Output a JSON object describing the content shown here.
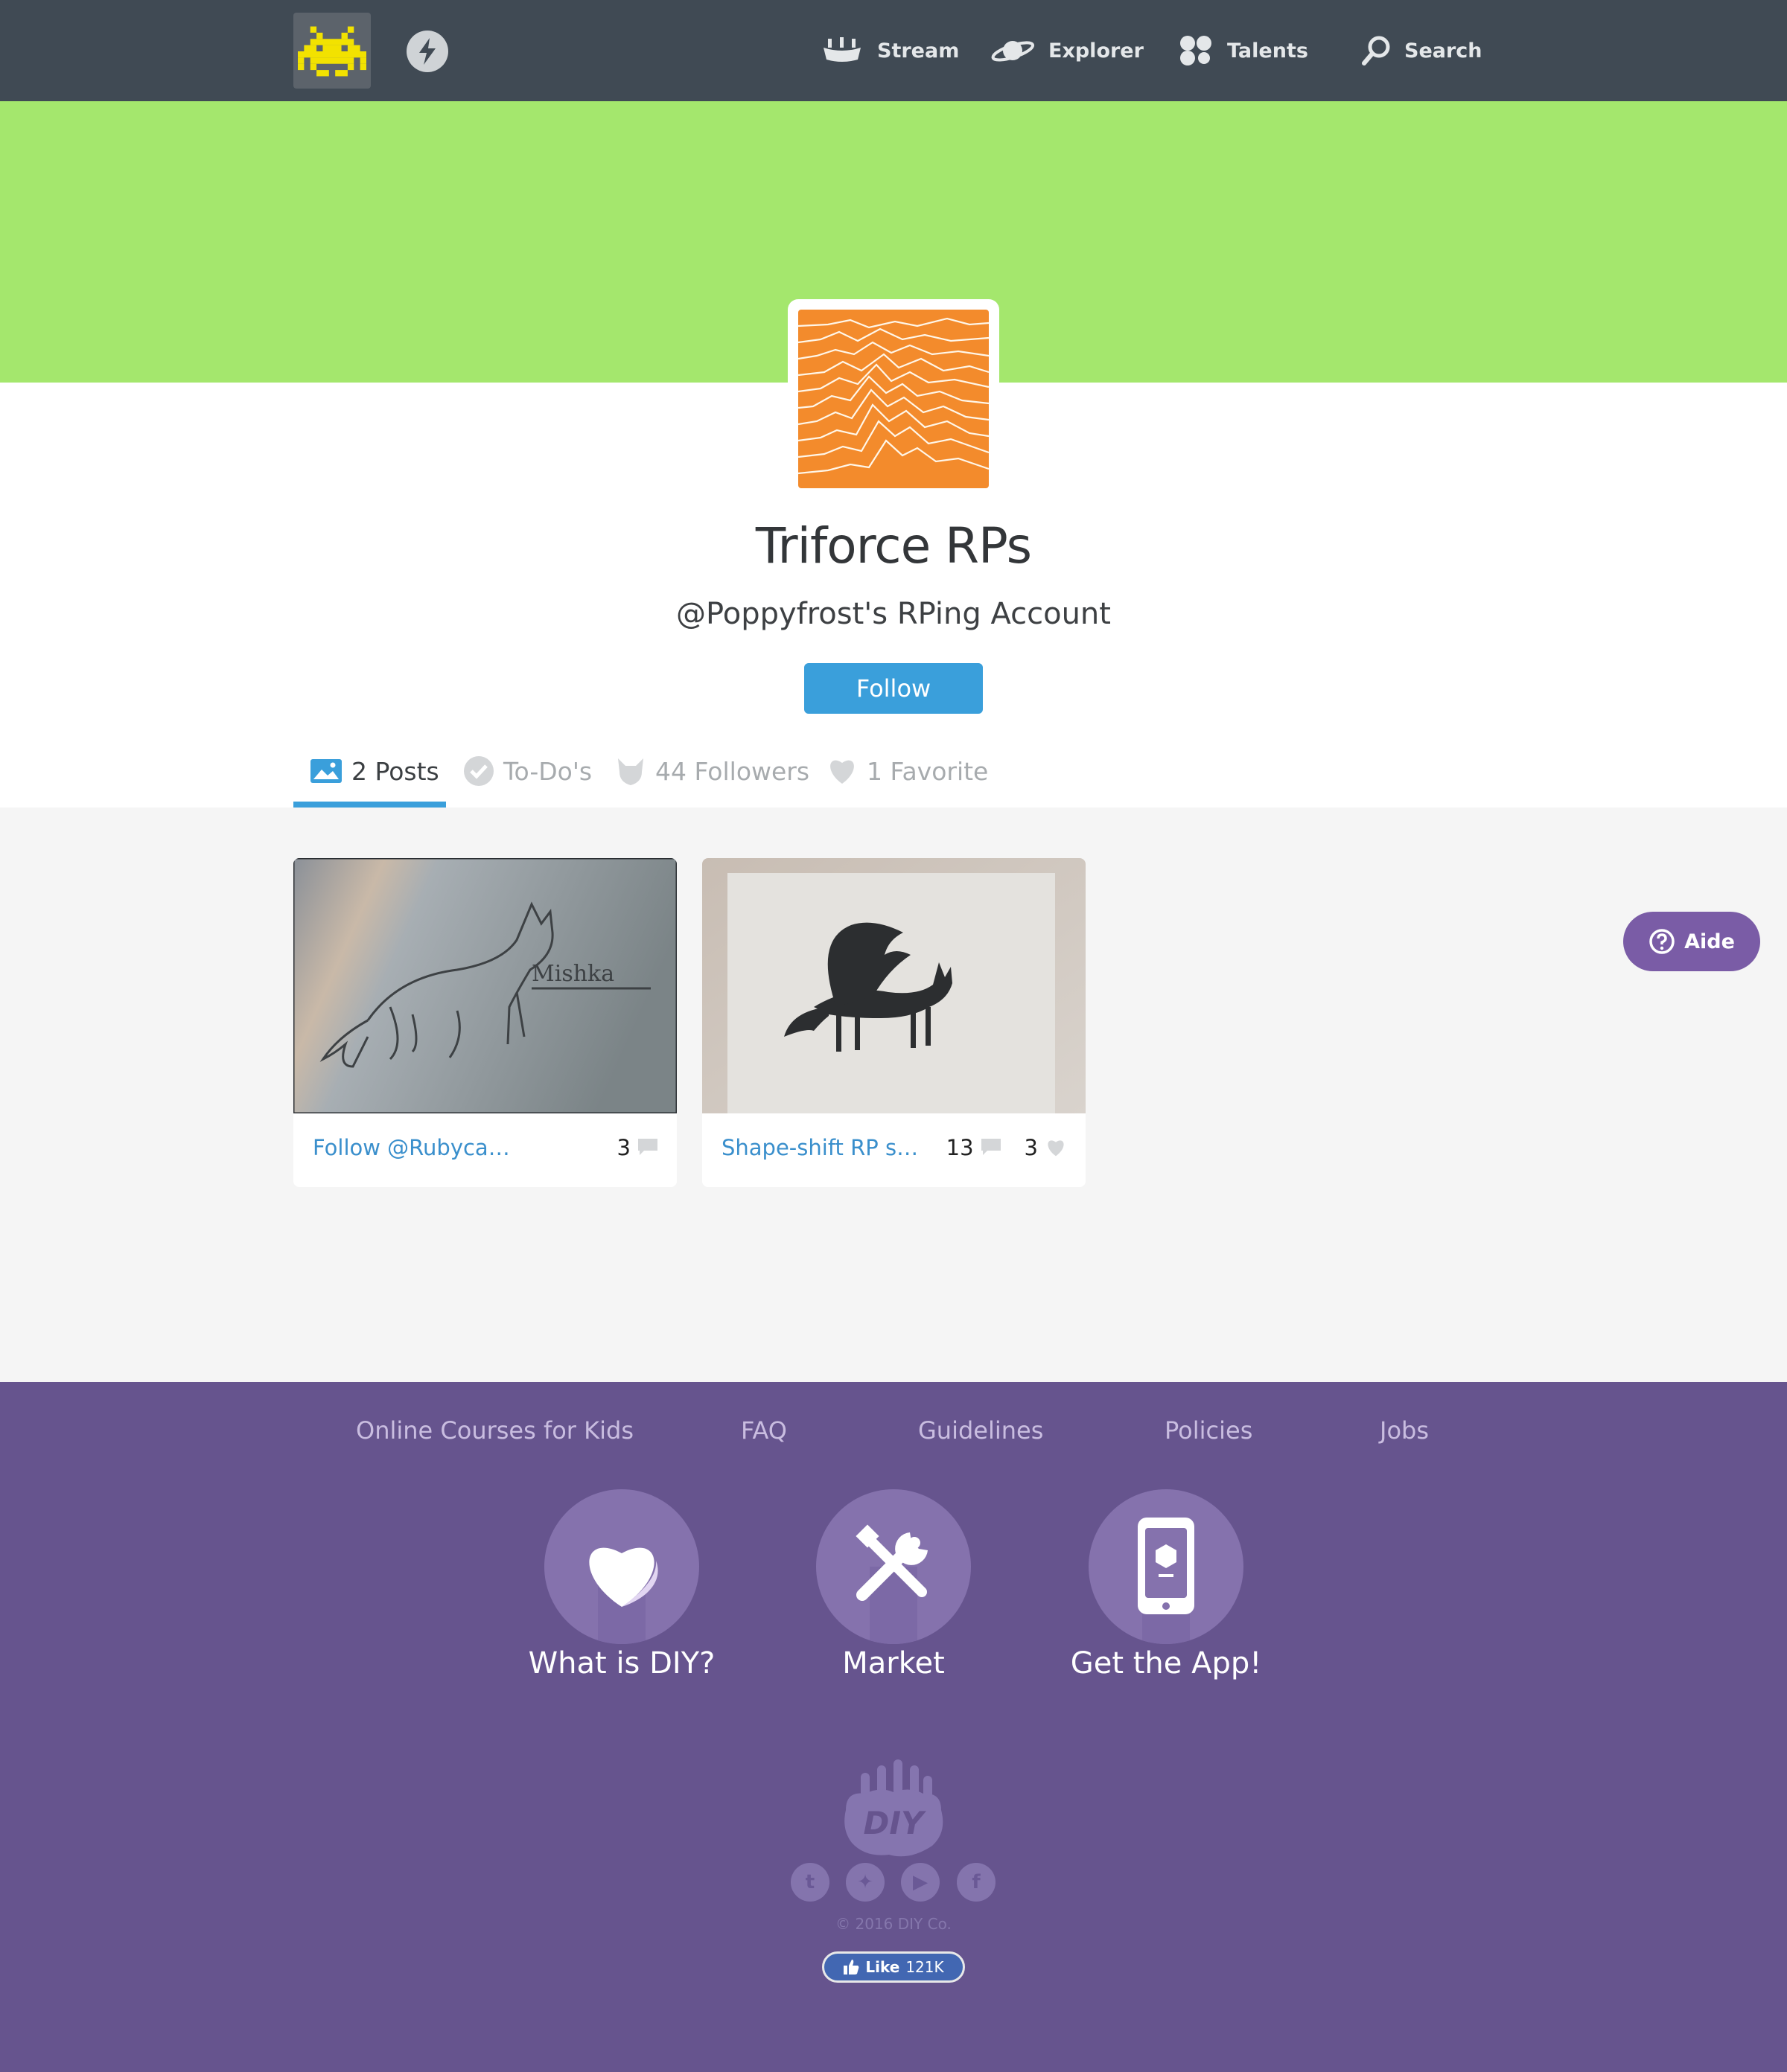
{
  "nav": {
    "items": [
      {
        "label": "Stream",
        "icon": "boat-icon"
      },
      {
        "label": "Explorer",
        "icon": "planet-icon"
      },
      {
        "label": "Talents",
        "icon": "talents-icon"
      },
      {
        "label": "Search",
        "icon": "search-icon"
      }
    ]
  },
  "profile": {
    "name": "Triforce RPs",
    "description": "@Poppyfrost's RPing Account",
    "follow_label": "Follow"
  },
  "tabs": [
    {
      "label": "2 Posts",
      "icon": "image-icon",
      "active": true
    },
    {
      "label": "To-Do's",
      "icon": "check-icon",
      "active": false
    },
    {
      "label": "44 Followers",
      "icon": "followers-icon",
      "active": false
    },
    {
      "label": "1 Favorite",
      "icon": "heart-icon",
      "active": false
    }
  ],
  "posts": [
    {
      "title": "Follow @Rubyca…",
      "comments": "3",
      "likes": null,
      "image": "wolf-sketch-mishka"
    },
    {
      "title": "Shape-shift RP s…",
      "comments": "13",
      "likes": "3",
      "image": "winged-fox-drawing"
    }
  ],
  "sketch_caption": "Mishka",
  "aide": {
    "label": "Aide",
    "icon": "help-icon"
  },
  "footer": {
    "links": [
      "Online Courses for Kids",
      "FAQ",
      "Guidelines",
      "Policies",
      "Jobs"
    ],
    "features": [
      {
        "label": "What is DIY?",
        "icon": "heart-icon"
      },
      {
        "label": "Market",
        "icon": "tools-icon"
      },
      {
        "label": "Get the App!",
        "icon": "phone-icon"
      }
    ],
    "logo_text": "DIY",
    "social": [
      {
        "name": "tumblr-icon",
        "glyph": "t"
      },
      {
        "name": "twitter-icon",
        "glyph": "✦"
      },
      {
        "name": "youtube-icon",
        "glyph": "▶"
      },
      {
        "name": "facebook-icon",
        "glyph": "f"
      }
    ],
    "copyright": "© 2016 DIY Co.",
    "fb_like": {
      "label": "Like",
      "count": "121K"
    }
  },
  "colors": {
    "nav_bg": "#404a54",
    "banner": "#a4e76d",
    "accent": "#3a9fdb",
    "footer_bg": "#66548e",
    "avatar": "#f38b2c",
    "aide": "#7a5ca6"
  }
}
